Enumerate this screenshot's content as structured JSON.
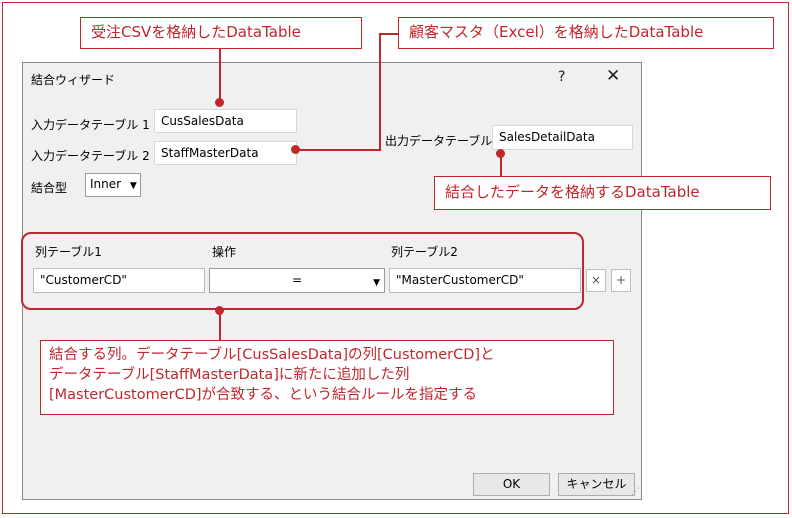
{
  "callouts": {
    "top_left": "受注CSVを格納したDataTable",
    "top_right": "顧客マスタ（Excel）を格納したDataTable",
    "output": "結合したデータを格納するDataTable",
    "note_lines": [
      "結合する列。データテーブル[CusSalesData]の列[CustomerCD]と",
      "データテーブル[StaffMasterData]に新たに追加した列",
      "[MasterCustomerCD]が合致する、という結合ルールを指定する"
    ]
  },
  "dialog": {
    "title": "結合ウィザード",
    "help": "?",
    "close": "✕",
    "input_table_1_label": "入力データテーブル 1",
    "input_table_1_value": "CusSalesData",
    "input_table_2_label": "入力データテーブル 2",
    "input_table_2_value": "StaffMasterData",
    "output_table_label": "出力データテーブル",
    "output_table_value": "SalesDetailData",
    "join_type_label": "結合型",
    "join_type_value": "Inner",
    "columns": {
      "header_col1": "列テーブル1",
      "header_op": "操作",
      "header_col2": "列テーブル2",
      "col1_value": "\"CustomerCD\"",
      "op_value": "=",
      "col2_value": "\"MasterCustomerCD\"",
      "remove": "×",
      "add": "+"
    },
    "ok": "OK",
    "cancel": "キャンセル"
  }
}
